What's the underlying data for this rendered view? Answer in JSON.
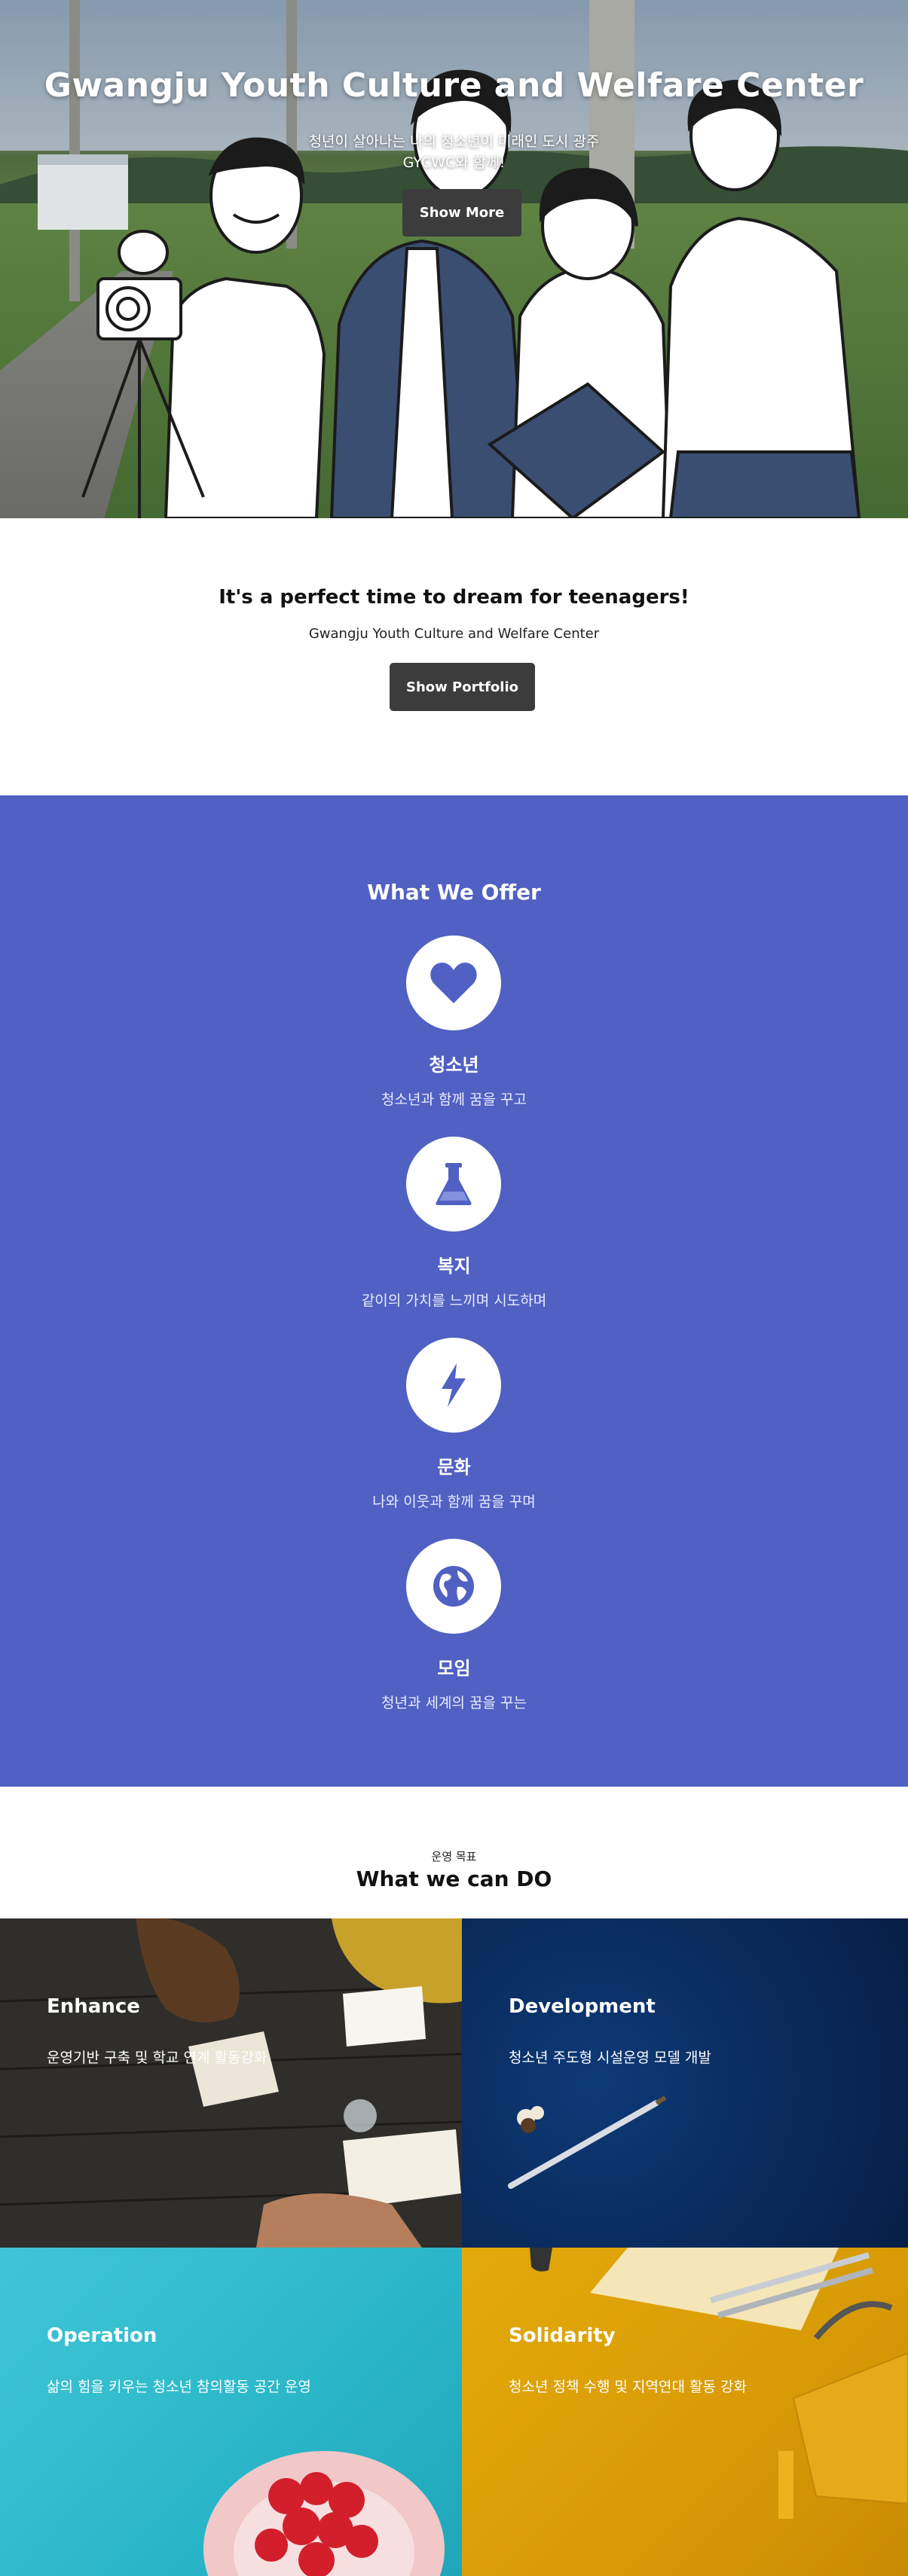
{
  "hero": {
    "title": "Gwangju Youth Culture and Welfare Center",
    "subtitle_line1": "청년이 살아나는 나의 청소년이 미래인 도시 광주",
    "subtitle_line2": "GYCWC와 함께!",
    "button_label": "Show More"
  },
  "intro": {
    "heading": "It's a perfect time to dream for teenagers!",
    "subheading": "Gwangju Youth Culture and Welfare Center",
    "button_label": "Show Portfolio"
  },
  "offer": {
    "heading": "What We Offer",
    "items": [
      {
        "icon": "heart-icon",
        "title": "청소년",
        "desc": "청소년과 함께 꿈을 꾸고"
      },
      {
        "icon": "flask-icon",
        "title": "복지",
        "desc": "같이의 가치를 느끼며 시도하며"
      },
      {
        "icon": "bolt-icon",
        "title": "문화",
        "desc": "나와 이웃과 함께 꿈을 꾸며"
      },
      {
        "icon": "globe-icon",
        "title": "모임",
        "desc": "청년과 세계의 꿈을 꾸는"
      }
    ],
    "accent": "#5061c3"
  },
  "goals": {
    "label": "운영 목표",
    "heading": "What we can DO",
    "tiles": [
      {
        "title": "Enhance",
        "desc": "운영기반 구축 및 학교 연계 활동강화"
      },
      {
        "title": "Development",
        "desc": "청소년 주도형 시설운영 모델 개발"
      },
      {
        "title": "Operation",
        "desc": "삶의 힘을 키우는 청소년 참의활동 공간 운영"
      },
      {
        "title": "Solidarity",
        "desc": "청소년 정책 수행 및 지역연대 활동 강화"
      }
    ]
  }
}
